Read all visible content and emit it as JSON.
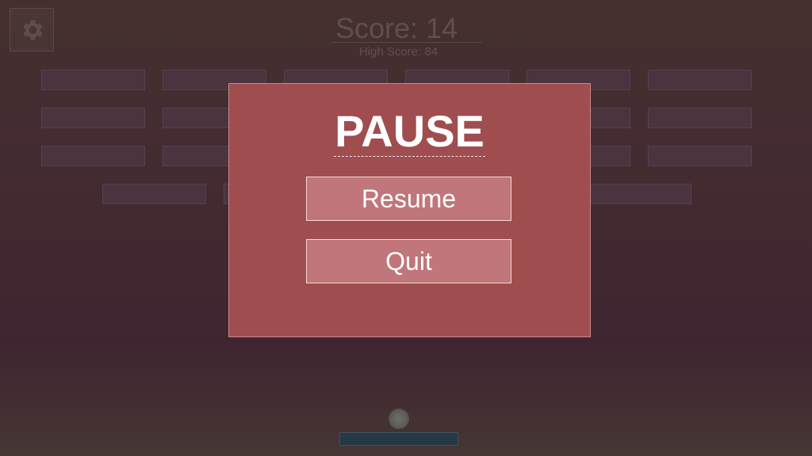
{
  "hud": {
    "score_text": "Score: 14",
    "high_score_text": "High Score: 84",
    "settings_icon": "gear-icon"
  },
  "pause_menu": {
    "title": "PAUSE",
    "resume_label": "Resume",
    "quit_label": "Quit"
  },
  "colors": {
    "overlay_panel": "#a04d4f",
    "button_fill": "#c0767a",
    "paddle": "#243846",
    "brick": "#4b3440"
  }
}
